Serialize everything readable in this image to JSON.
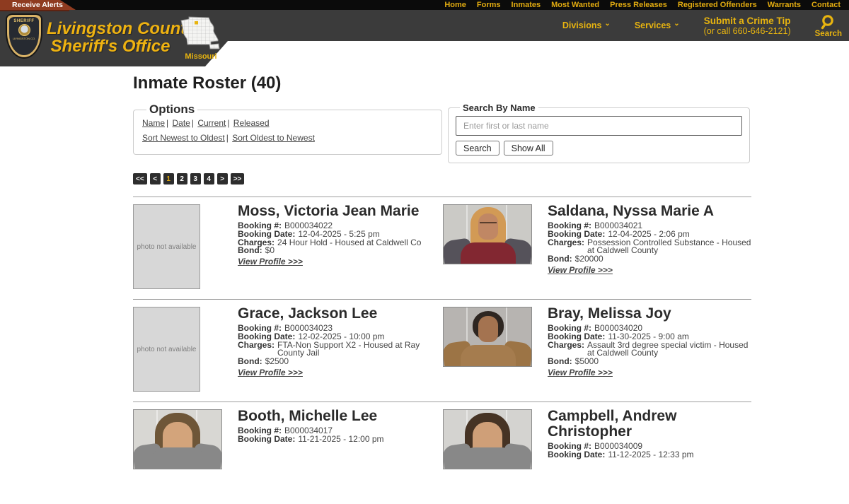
{
  "topnav": {
    "alert_label": "Receive Alerts",
    "links": [
      "Home",
      "Forms",
      "Inmates",
      "Most Wanted",
      "Press Releases",
      "Registered Offenders",
      "Warrants",
      "Contact"
    ]
  },
  "header": {
    "org_line1": "Livingston County",
    "org_line2": "Sheriff's Office",
    "badge_text_top": "SHERIFF",
    "badge_text_sub": "LIVINGSTON CO.",
    "state_label": "Missouri",
    "menus": [
      {
        "label": "Divisions"
      },
      {
        "label": "Services"
      }
    ],
    "crime_tip_line1": "Submit a Crime Tip",
    "crime_tip_line2": "(or call 660-646-2121)",
    "search_label": "Search",
    "accent_color": "#e8b40f",
    "header_bg": "#3b3b3b",
    "topbar_bg": "#0b0b0b",
    "alert_bg": "#8e3b20"
  },
  "page": {
    "title": "Inmate Roster (40)"
  },
  "options": {
    "legend": "Options",
    "filters": [
      "Name",
      "Date",
      "Current",
      "Released"
    ],
    "sorts": [
      "Sort Newest to Oldest",
      "Sort Oldest to Newest"
    ]
  },
  "search": {
    "legend": "Search By Name",
    "placeholder": "Enter first or last name",
    "value": "",
    "search_button": "Search",
    "show_all_button": "Show All"
  },
  "pagination": {
    "items": [
      "<<",
      "<",
      "1",
      "2",
      "3",
      "4",
      ">",
      ">>"
    ],
    "current": "1"
  },
  "roster": {
    "no_photo_label": "photo not available",
    "labels": {
      "booking_no": "Booking #:",
      "booking_date": "Booking Date:",
      "charges": "Charges:",
      "bond": "Bond:",
      "view_profile": "View Profile >>>"
    },
    "entries": [
      {
        "name": "Moss, Victoria Jean Marie",
        "booking_no": "B000034022",
        "booking_date": "12-04-2025 - 5:25 pm",
        "charges": "24 Hour Hold - Housed at Caldwell Co",
        "bond": "$0",
        "photo": {
          "kind": "placeholder"
        }
      },
      {
        "name": "Saldana, Nyssa Marie A",
        "booking_no": "B000034021",
        "booking_date": "12-04-2025 - 2:06 pm",
        "charges": "Possession Controlled Substance - Housed at Caldwell County",
        "bond": "$20000",
        "photo": {
          "kind": "mugshot",
          "c_wall": "#cbcac6",
          "c_hair": "#d29a55",
          "c_skin": "#c08764",
          "c_top": "#822731",
          "c_jacket": "#55525a"
        }
      },
      {
        "name": "Grace, Jackson Lee",
        "booking_no": "B000034023",
        "booking_date": "12-02-2025 - 10:00 pm",
        "charges": "FTA-Non Support X2 - Housed at Ray County Jail",
        "bond": "$2500",
        "photo": {
          "kind": "placeholder"
        }
      },
      {
        "name": "Bray, Melissa Joy",
        "booking_no": "B000034020",
        "booking_date": "11-30-2025 - 9:00 am",
        "charges": "Assault 3rd degree special victim - Housed at Caldwell County",
        "bond": "$5000",
        "photo": {
          "kind": "mugshot",
          "c_wall": "#b7b4b1",
          "c_hair": "#2e2621",
          "c_skin": "#a47350",
          "c_top": "#a57c4e",
          "c_jacket": "#9c7445"
        }
      },
      {
        "name": "Booth, Michelle Lee",
        "booking_no": "B000034017",
        "booking_date": "11-21-2025 - 12:00 pm",
        "photo": {
          "kind": "mugshot",
          "c_wall": "#d8d7d3",
          "c_hair": "#6e5638",
          "c_skin": "#d3a47b",
          "c_top": "#888888",
          "c_jacket": "#888888"
        }
      },
      {
        "name": "Campbell, Andrew Christopher",
        "booking_no": "B000034009",
        "booking_date": "11-12-2025 - 12:33 pm",
        "photo": {
          "kind": "mugshot",
          "c_wall": "#d4d3d0",
          "c_hair": "#463324",
          "c_skin": "#cf9f78",
          "c_top": "#888888",
          "c_jacket": "#888888"
        }
      }
    ]
  }
}
